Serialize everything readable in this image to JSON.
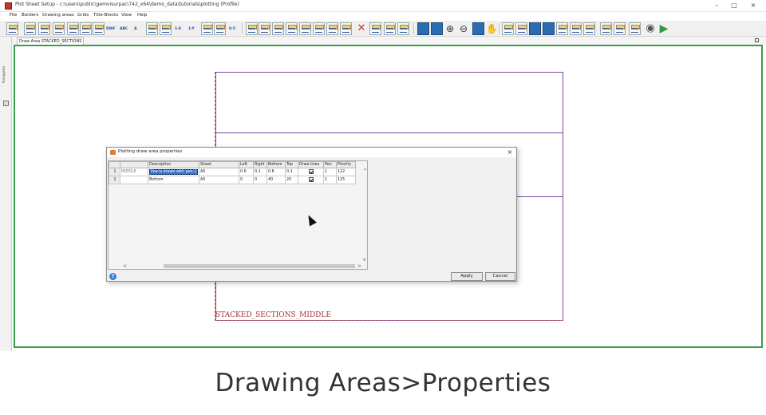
{
  "window": {
    "title": "Plot Sheet Setup - c:\\users\\public\\gemvisurpac\\742_x64\\demo_data\\tutorials\\plotting (Profile)",
    "minimize": "–",
    "maximize": "□",
    "close": "×"
  },
  "menu": [
    "File",
    "Borders",
    "Drawing areas",
    "Grids",
    "Title-Blocks",
    "View",
    "Help"
  ],
  "toolbar": {
    "labels": [
      "DWF",
      "ABC",
      "A",
      "1-X",
      "1-Y",
      "0.5"
    ]
  },
  "tab": {
    "label": "Draw Area STACKED_SECTIONS"
  },
  "navigator": {
    "label": "Navigator"
  },
  "canvas": {
    "area_label": "STACKED_SECTIONS_MIDDLE",
    "accent": "#3a9d4a",
    "area_line_color": "#7b4a9e"
  },
  "dialog": {
    "title": "Plotting draw area properties",
    "close": "×",
    "columns": [
      "",
      "",
      "Description",
      "Sheet",
      "Left",
      "Right",
      "Bottom",
      "Top",
      "Draw lines",
      "Pen",
      "Priority"
    ],
    "rows": [
      {
        "num": "1",
        "name": "MIDDLE",
        "description": "line is drawn with pen 1",
        "sheet": "A0",
        "left": "0.6",
        "right": "0.1",
        "bottom": "0.6",
        "top": "0.1",
        "draw_lines": true,
        "pen": "1",
        "priority": "122"
      },
      {
        "num": "2",
        "name": "",
        "description": "Bottom",
        "sheet": "A0",
        "left": "0",
        "right": "0",
        "bottom": "40",
        "top": "20",
        "draw_lines": true,
        "pen": "1",
        "priority": "125"
      }
    ],
    "scroll_up": "^",
    "scroll_down": "v",
    "scroll_left": "<",
    "scroll_right": ">",
    "help": "?",
    "apply": "Apply",
    "cancel": "Cancel"
  },
  "caption": "Drawing Areas>Properties"
}
